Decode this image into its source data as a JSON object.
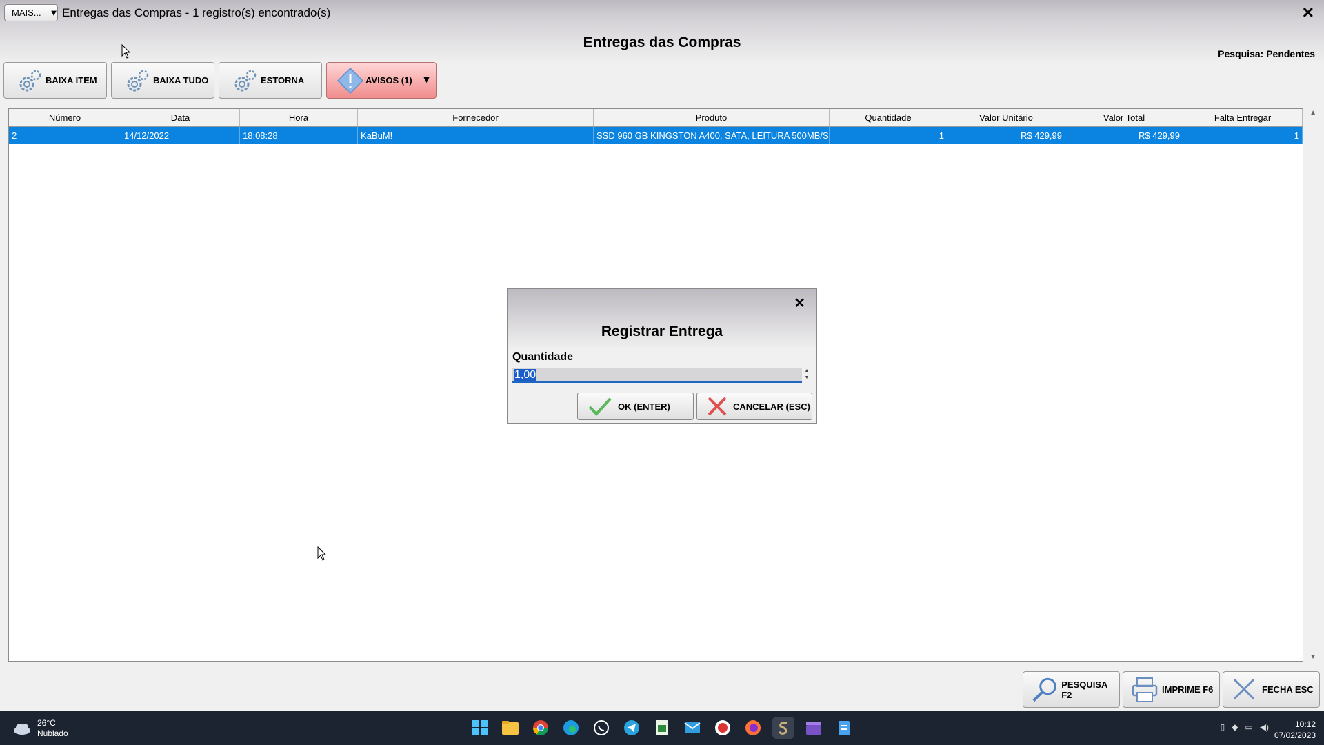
{
  "window": {
    "more_label": "MAIS...",
    "more_arrow": "▼",
    "title": "Entregas das Compras - 1 registro(s) encontrado(s)",
    "close_glyph": "✕"
  },
  "page": {
    "heading": "Entregas das Compras",
    "search_status": "Pesquisa: Pendentes"
  },
  "toolbar": {
    "baixa_item": "BAIXA ITEM",
    "baixa_tudo": "BAIXA TUDO",
    "estorna": "ESTORNA",
    "avisos": "AVISOS (1)",
    "avisos_arrow": "▼"
  },
  "table": {
    "columns": [
      "Número",
      "Data",
      "Hora",
      "Fornecedor",
      "Produto",
      "Quantidade",
      "Valor Unitário",
      "Valor Total",
      "Falta Entregar"
    ],
    "rows": [
      [
        "2",
        "14/12/2022",
        "18:08:28",
        "KaBuM!",
        "SSD 960 GB KINGSTON A400, SATA, LEITURA 500MB/S",
        "1",
        "R$ 429,99",
        "R$ 429,99",
        "1"
      ]
    ]
  },
  "dialog": {
    "close_glyph": "✕",
    "title": "Registrar Entrega",
    "quantity_label": "Quantidade",
    "quantity_value": "1,00",
    "ok_label": "OK (ENTER)",
    "cancel_label": "CANCELAR (ESC)"
  },
  "bottom_bar": {
    "search": "PESQUISA F2",
    "print": "IMPRIME F6",
    "close": "FECHA ESC"
  },
  "taskbar": {
    "temperature": "26°C",
    "weather": "Nublado",
    "time": "10:12",
    "date": "07/02/2023",
    "apps": [
      "windows-start-icon",
      "file-explorer-icon",
      "chrome-icon",
      "edge-icon",
      "whatsapp-icon",
      "telegram-icon",
      "spreadsheet-icon",
      "mail-icon",
      "app-red-icon",
      "firefox-icon",
      "app-s-icon",
      "clapper-icon",
      "notepad-icon"
    ]
  },
  "colors": {
    "selection_row": "#0a84e0",
    "avisos_bg": "#f08c8c",
    "taskbar_bg": "#1d2431"
  }
}
